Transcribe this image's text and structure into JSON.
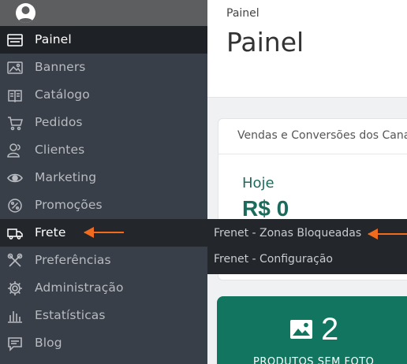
{
  "sidebar": {
    "items": [
      {
        "label": "Painel",
        "icon": "dashboard-icon"
      },
      {
        "label": "Banners",
        "icon": "image-icon"
      },
      {
        "label": "Catálogo",
        "icon": "book-icon"
      },
      {
        "label": "Pedidos",
        "icon": "cart-icon"
      },
      {
        "label": "Clientes",
        "icon": "users-icon"
      },
      {
        "label": "Marketing",
        "icon": "eye-icon"
      },
      {
        "label": "Promoções",
        "icon": "percent-badge-icon"
      },
      {
        "label": "Frete",
        "icon": "truck-icon"
      },
      {
        "label": "Preferências",
        "icon": "tools-icon"
      },
      {
        "label": "Administração",
        "icon": "gear-icon"
      },
      {
        "label": "Estatísticas",
        "icon": "bar-chart-icon"
      },
      {
        "label": "Blog",
        "icon": "message-icon"
      }
    ]
  },
  "flyout": {
    "items": [
      "Frenet - Zonas Bloqueadas",
      "Frenet - Configuração"
    ]
  },
  "header": {
    "breadcrumb": "Painel",
    "title": "Painel"
  },
  "sales_card": {
    "title": "Vendas e Conversões dos Canais",
    "period": "Hoje",
    "value": "R$ 0"
  },
  "photo_card": {
    "count": "2",
    "caption": "PRODUTOS SEM FOTO"
  },
  "colors": {
    "sidebar": "#383f48",
    "active": "#1e2227",
    "accent_green": "#12755f",
    "annotation_arrow": "#f26b1d"
  }
}
